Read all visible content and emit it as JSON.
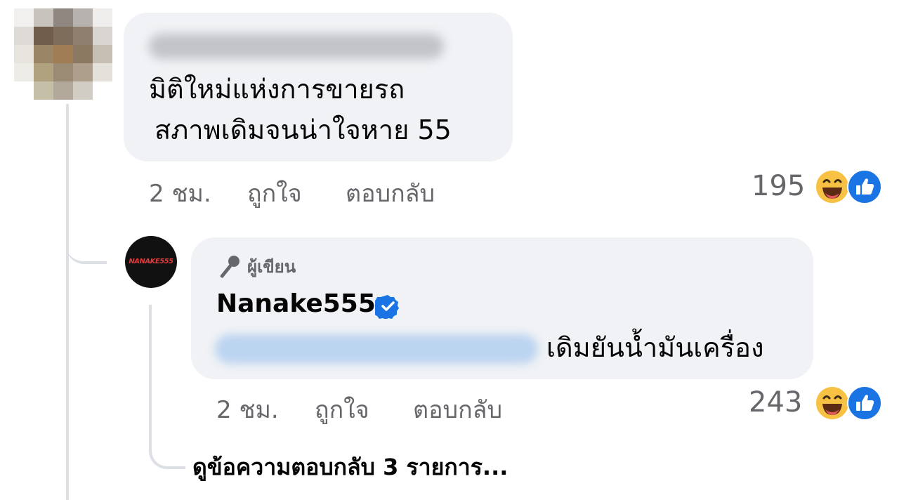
{
  "comment1": {
    "text_line1": "มิติใหม่แห่งการขายรถ",
    "text_line2": "สภาพเดิมจนน่าใจหาย 55",
    "time": "2 ชม.",
    "like_label": "ถูกใจ",
    "reply_label": "ตอบกลับ",
    "reaction_count": "195",
    "reactions": [
      "haha-emoji-icon",
      "like-icon"
    ]
  },
  "reply1": {
    "author_badge": "ผู้เขียน",
    "author_badge_icon": "microphone-icon",
    "page_name": "Nanake555",
    "verified_icon": "verified-badge-icon",
    "text": "เดิมยันน้ำมันเครื่อง",
    "time": "2 ชม.",
    "like_label": "ถูกใจ",
    "reply_label": "ตอบกลับ",
    "reaction_count": "243",
    "reactions": [
      "haha-emoji-icon",
      "like-icon"
    ],
    "avatar_logo": "NANAKE555"
  },
  "view_replies": "ดูข้อความตอบกลับ 3 รายการ...",
  "colors": {
    "bubble": "#f0f2f5",
    "meta_text": "#65676b",
    "like_blue": "#1b74e4",
    "haha_yellow": "#f7c144"
  }
}
